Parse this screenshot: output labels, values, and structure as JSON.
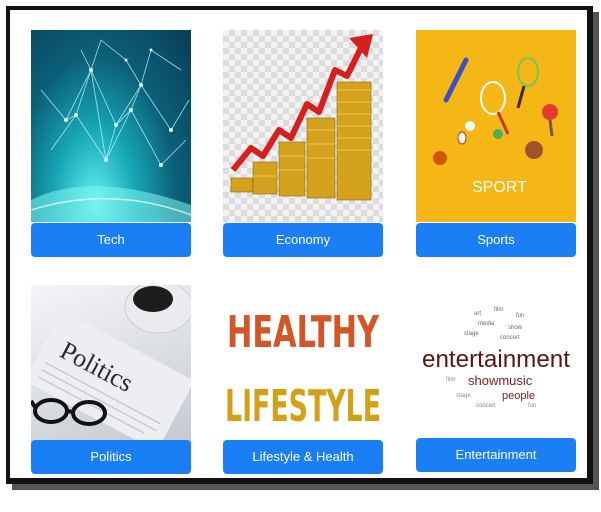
{
  "cards": [
    {
      "label": "Tech"
    },
    {
      "label": "Economy"
    },
    {
      "label": "Sports"
    },
    {
      "label": "Politics"
    },
    {
      "label": "Lifestyle & Health"
    },
    {
      "label": "Entertainment"
    }
  ],
  "images": {
    "sports_caption": "SPORT",
    "politics_headline": "Politics",
    "lifestyle_line1": "HEALTHY",
    "lifestyle_line2": "LIFESTYLE",
    "entertainment_main": "entertainment",
    "entertainment_words": [
      "showmusic",
      "people",
      "stage",
      "concert",
      "fun",
      "film",
      "media",
      "art",
      "show"
    ]
  },
  "colors": {
    "button_blue": "#1a7ff5",
    "button_text": "#ffffff",
    "sports_bg": "#f5b716"
  }
}
